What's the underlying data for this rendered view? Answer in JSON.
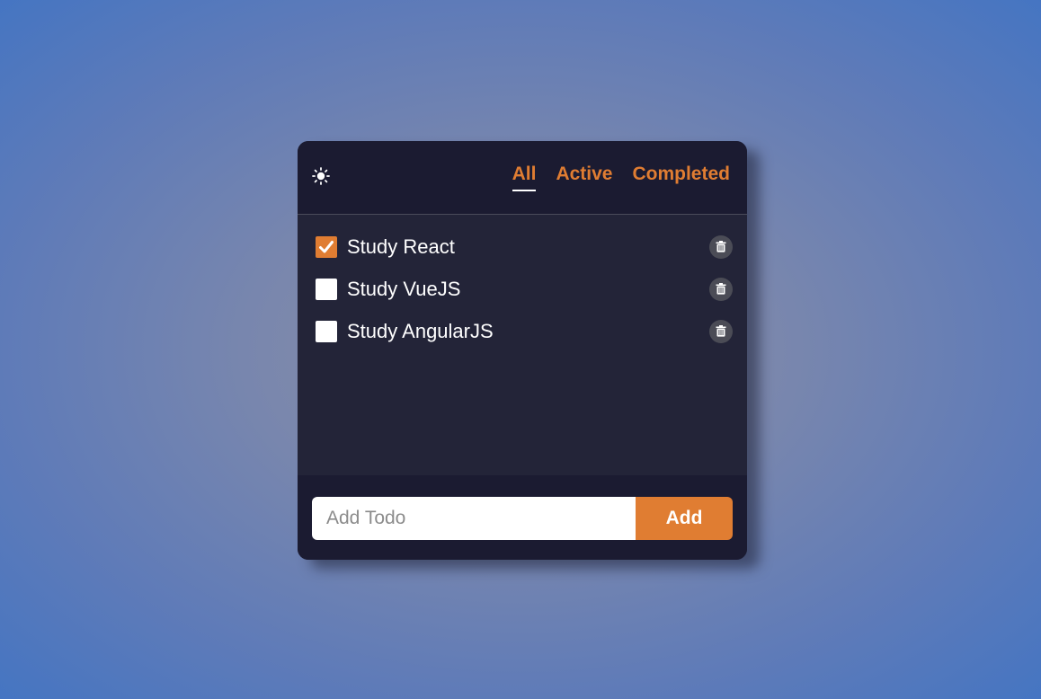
{
  "header": {
    "theme_icon": "sun-icon",
    "tabs": [
      {
        "label": "All",
        "active": true
      },
      {
        "label": "Active",
        "active": false
      },
      {
        "label": "Completed",
        "active": false
      }
    ]
  },
  "todos": [
    {
      "label": "Study React",
      "completed": true
    },
    {
      "label": "Study VueJS",
      "completed": false
    },
    {
      "label": "Study AngularJS",
      "completed": false
    }
  ],
  "footer": {
    "input_placeholder": "Add Todo",
    "input_value": "",
    "add_label": "Add"
  },
  "colors": {
    "accent": "#e07d32",
    "card_bg": "#232438",
    "header_bg": "#1b1b31"
  }
}
